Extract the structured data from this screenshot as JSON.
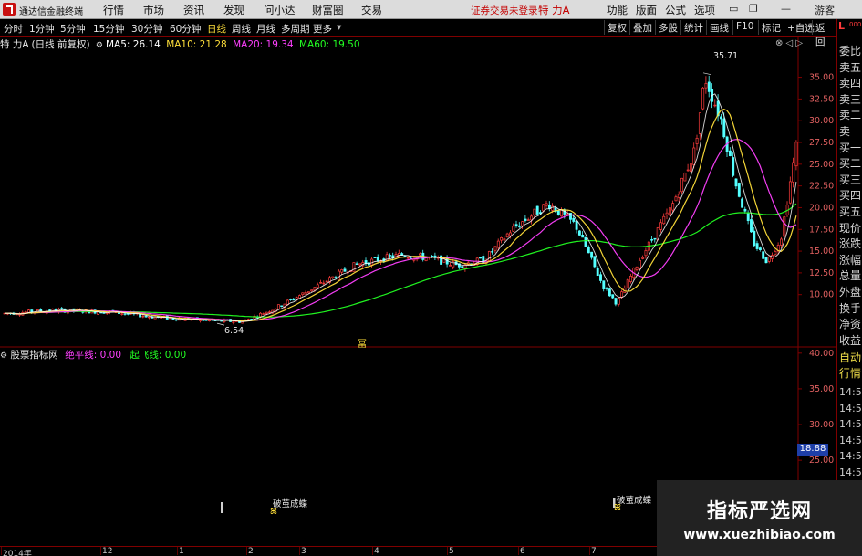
{
  "titlebar": {
    "app_name": "通达信金融终端",
    "menus": [
      "行情",
      "市场",
      "资讯",
      "发现",
      "问小达",
      "财富圈",
      "交易"
    ],
    "login_status": "证券交易未登录",
    "stock_name": "特 力A",
    "right_menus": [
      "功能",
      "版面",
      "公式",
      "选项"
    ],
    "user": "游客"
  },
  "toolbar": {
    "periods": [
      "分时",
      "1分钟",
      "5分钟",
      "15分钟",
      "30分钟",
      "60分钟",
      "日线",
      "周线",
      "月线",
      "多周期",
      "更多"
    ],
    "active_period": "日线",
    "buttons": [
      "复权",
      "叠加",
      "多股",
      "统计",
      "画线",
      "F10",
      "标记",
      "+自选",
      "返回"
    ]
  },
  "main_header": {
    "stock": "特 力A",
    "mode": "(日线 前复权)",
    "ma5": "MA5: 26.14",
    "ma10": "MA10: 21.28",
    "ma20": "MA20: 19.34",
    "ma60": "MA60: 19.50"
  },
  "indicator_header": {
    "name": "股票指标网",
    "line1": "绝平线: 0.00",
    "line2": "起飞线: 0.00"
  },
  "annotations": {
    "high": "35.71",
    "low": "6.54",
    "signal1": "破茧成蝶",
    "signal2": "破茧成蝶",
    "current_value": "18.88"
  },
  "price_axis": [
    "35.00",
    "32.50",
    "30.00",
    "27.50",
    "25.00",
    "22.50",
    "20.00",
    "17.50",
    "15.00",
    "12.50",
    "10.00"
  ],
  "ind_axis": [
    "40.00",
    "35.00",
    "30.00",
    "25.00",
    "20.00",
    "15.00"
  ],
  "date_axis": [
    "2014年",
    "12",
    "1",
    "2",
    "3",
    "4",
    "5",
    "6",
    "7"
  ],
  "right_panel": {
    "corner": "L",
    "corner_sub": "000",
    "items": [
      "委比",
      "卖五",
      "卖四",
      "卖三",
      "卖二",
      "卖一",
      "买一",
      "买二",
      "买三",
      "买四",
      "买五",
      "现价",
      "涨跌",
      "涨幅",
      "总量",
      "外盘",
      "换手",
      "净资",
      "收益"
    ],
    "items2": [
      "自动",
      "行情"
    ],
    "times": [
      "14:55",
      "14:55",
      "14:55",
      "14:56",
      "14:56",
      "14:56",
      "14:56",
      "14:56",
      "14:56"
    ]
  },
  "watermark": {
    "title": "指标严选网",
    "url": "www.xuezhibiao.com"
  },
  "colors": {
    "up": "#ff3c3c",
    "down": "#54ffff",
    "ma5": "#ffffff",
    "ma10": "#ffdf3a",
    "ma20": "#ff40ff",
    "ma60": "#22ff22",
    "axis": "#800000"
  },
  "chart_data": {
    "type": "candlestick",
    "y_range": [
      4.3,
      38.0
    ],
    "moving_averages": [
      "MA5",
      "MA10",
      "MA20",
      "MA60"
    ],
    "ma_last": {
      "MA5": 26.14,
      "MA10": 21.28,
      "MA20": 19.34,
      "MA60": 19.5
    },
    "high": 35.71,
    "low": 6.54
  }
}
